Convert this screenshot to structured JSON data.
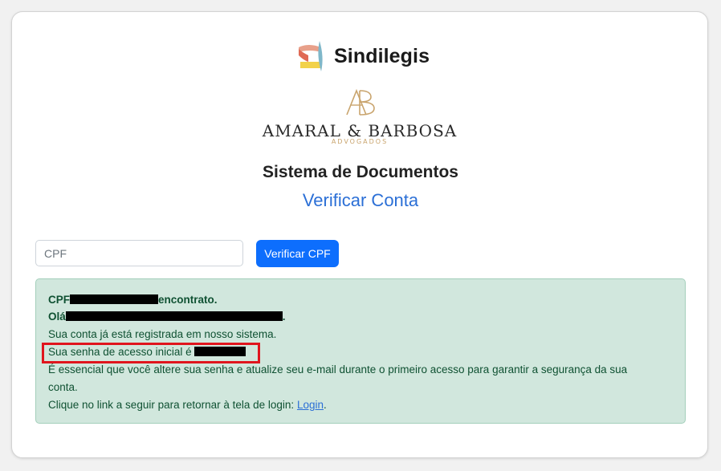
{
  "brand": {
    "primary_logo_text": "Sindilegis",
    "partner_firm": "AMARAL & BARBOSA",
    "partner_firm_sub": "ADVOGADOS",
    "partner_monogram": "AB"
  },
  "header": {
    "title": "Sistema de Documentos",
    "subtitle": "Verificar Conta"
  },
  "form": {
    "cpf_placeholder": "CPF",
    "cpf_value": "",
    "submit_label": "Verificar CPF"
  },
  "alert": {
    "cpf_prefix": "CPF",
    "cpf_suffix": "encontrato.",
    "greeting_prefix": "Olá",
    "greeting_suffix": ".",
    "registered_msg": "Sua conta já está registrada em nosso sistema.",
    "initial_password_msg": "Sua senha de acesso inicial é",
    "security_msg_1": "É essencial que você altere sua senha e atualize seu e-mail durante o primeiro acesso para garantir a segurança da sua",
    "security_msg_2": "conta.",
    "login_msg_prefix": "Clique no link a seguir para retornar à tela de login:",
    "login_link": "Login",
    "login_msg_suffix": "."
  },
  "colors": {
    "accent": "#0d6efd",
    "subtitle_blue": "#2b6fd6",
    "alert_bg": "#d1e7dd",
    "alert_text": "#0f5132",
    "highlight_red": "#e0151d",
    "gold": "#c9a46d"
  }
}
